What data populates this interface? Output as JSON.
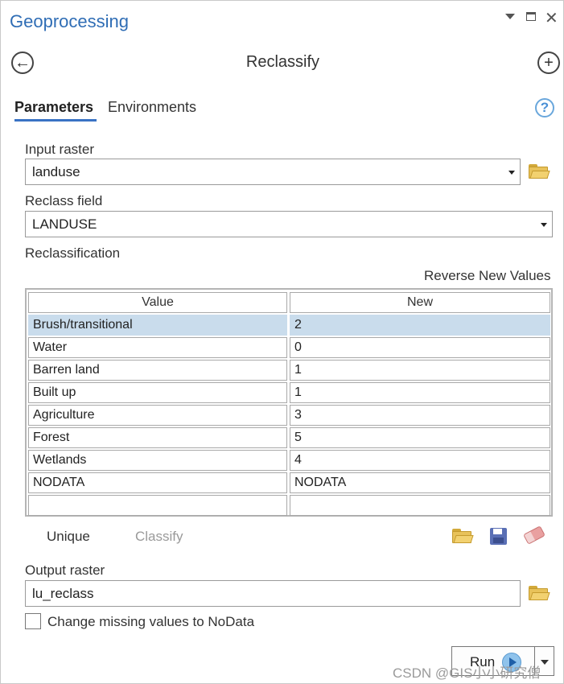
{
  "window": {
    "title": "Geoprocessing"
  },
  "tool": {
    "title": "Reclassify"
  },
  "tabs": [
    {
      "label": "Parameters",
      "active": true
    },
    {
      "label": "Environments",
      "active": false
    }
  ],
  "help_icon": "?",
  "input_raster": {
    "label": "Input raster",
    "value": "landuse"
  },
  "reclass_field": {
    "label": "Reclass field",
    "value": "LANDUSE"
  },
  "reclassification": {
    "label": "Reclassification",
    "reverse_label": "Reverse New Values",
    "columns": [
      "Value",
      "New"
    ],
    "rows": [
      {
        "value": "Brush/transitional",
        "new": "2"
      },
      {
        "value": "Water",
        "new": "0"
      },
      {
        "value": "Barren land",
        "new": "1"
      },
      {
        "value": "Built up",
        "new": "1"
      },
      {
        "value": "Agriculture",
        "new": "3"
      },
      {
        "value": "Forest",
        "new": "5"
      },
      {
        "value": "Wetlands",
        "new": "4"
      },
      {
        "value": "NODATA",
        "new": "NODATA"
      },
      {
        "value": "",
        "new": ""
      }
    ],
    "unique_label": "Unique",
    "classify_label": "Classify"
  },
  "output_raster": {
    "label": "Output raster",
    "value": "lu_reclass"
  },
  "missing_values": {
    "label": "Change missing values to NoData",
    "checked": false
  },
  "run": {
    "label": "Run"
  },
  "watermark": "CSDN @GIS小小研究僧",
  "colors": {
    "accent": "#2f6db5",
    "selected_row": "#c9dcec",
    "folder": "#e8c25a"
  }
}
